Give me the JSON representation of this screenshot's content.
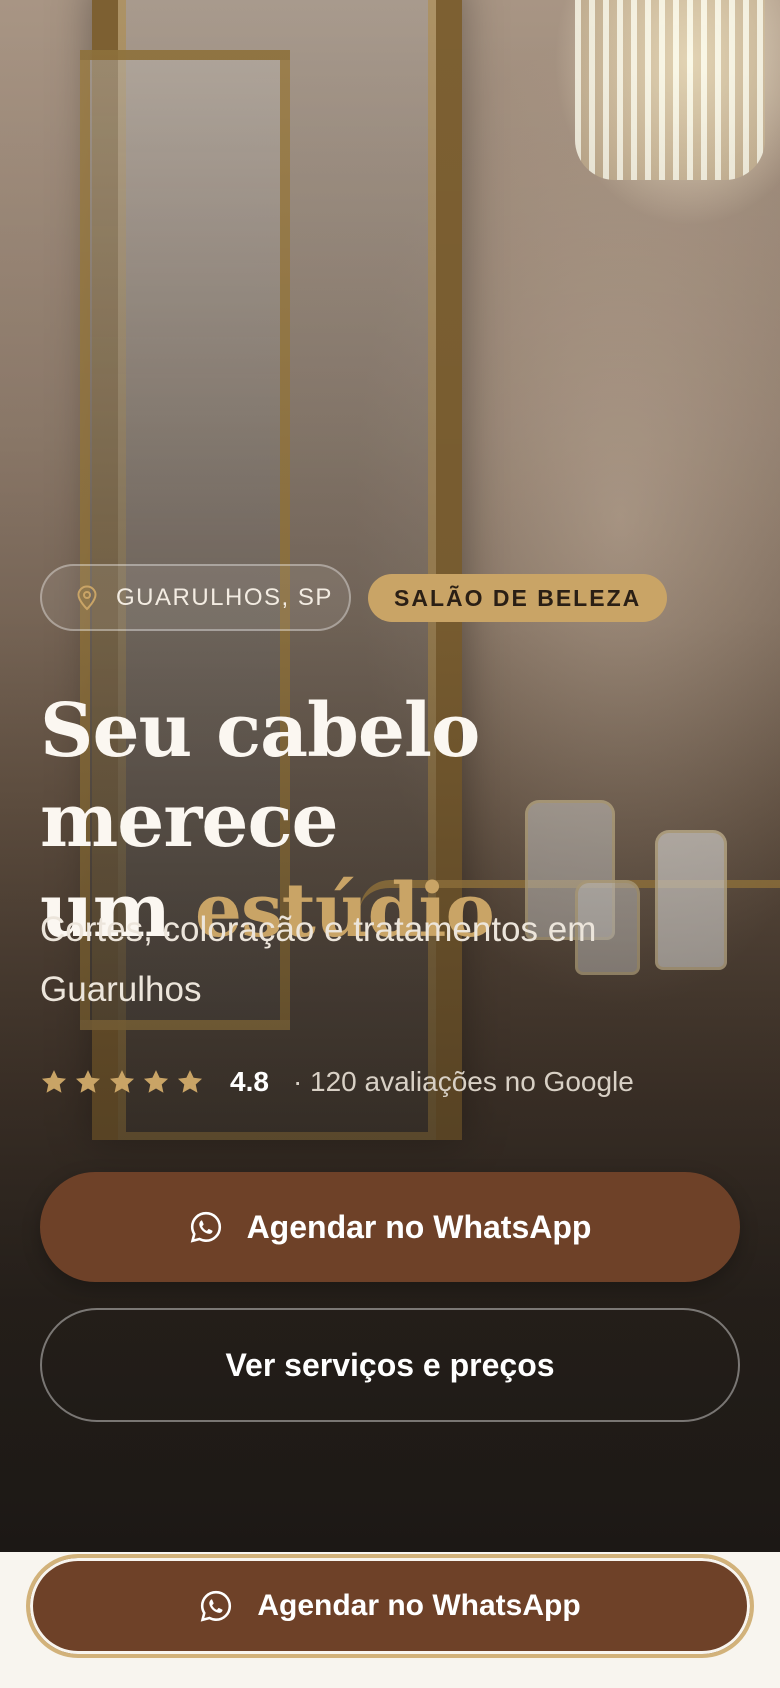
{
  "hero": {
    "location_badge": "GUARULHOS, SP",
    "category_badge": "SALÃO DE BELEZA",
    "headline_line1": "Seu cabelo merece",
    "headline_line2_prefix": "um ",
    "headline_accent": "estúdio",
    "subtitle": "Cortes, coloração e tratamentos em Guarulhos",
    "rating": {
      "stars": 5,
      "score": "4.8",
      "reviews_text": "· 120 avaliações no Google"
    },
    "primary_button": "Agendar no WhatsApp",
    "secondary_button": "Ver serviços e preços"
  },
  "sticky_cta": {
    "label": "Agendar no WhatsApp"
  },
  "icons": {
    "location": "map-pin-icon",
    "whatsapp": "whatsapp-icon",
    "star": "star-icon"
  },
  "colors": {
    "accent_gold": "#c9a466",
    "button_brown": "#6e4128",
    "sticky_bg": "#f8f5ef"
  }
}
